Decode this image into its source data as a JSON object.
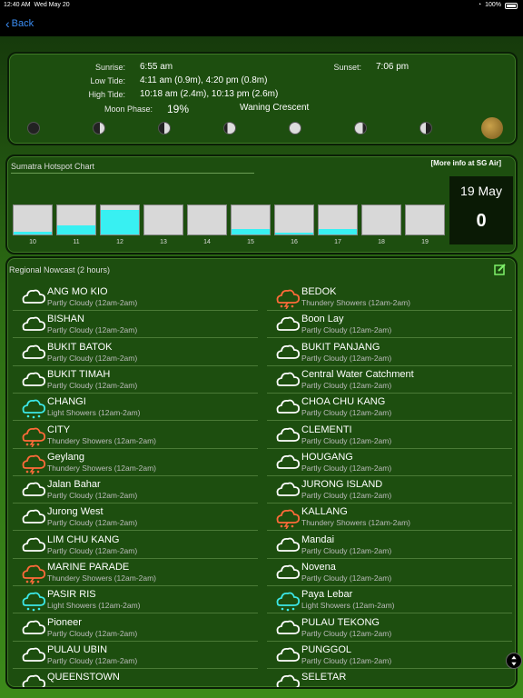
{
  "status": {
    "time": "12:40 AM",
    "date": "Wed May 20",
    "battery": "100%"
  },
  "nav": {
    "back": "Back"
  },
  "info": {
    "sunrise_label": "Sunrise:",
    "sunrise": "6:55 am",
    "sunset_label": "Sunset:",
    "sunset": "7:06 pm",
    "lowtide_label": "Low Tide:",
    "lowtide": "4:11 am (0.9m), 4:20 pm (0.8m)",
    "hightide_label": "High Tide:",
    "hightide": "10:18 am (2.4m), 10:13 pm (2.6m)",
    "moon_label": "Moon Phase:",
    "moon_pct": "19%",
    "moon_phase": "Waning Crescent"
  },
  "hotspot": {
    "title": "Sumatra Hotspot Chart",
    "more": "[More info at SG Air]",
    "date": "19 May",
    "count": "0",
    "chart_data": {
      "type": "bar",
      "categories": [
        "10",
        "11",
        "12",
        "13",
        "14",
        "15",
        "16",
        "17",
        "18",
        "19"
      ],
      "values": [
        0.1,
        0.3,
        0.85,
        0,
        0,
        0.2,
        0.05,
        0.2,
        0,
        0
      ]
    }
  },
  "nowcast": {
    "title": "Regional Nowcast (2 hours)",
    "items": [
      {
        "name": "ANG MO KIO",
        "desc": "Partly Cloudy (12am-2am)",
        "type": "cloud"
      },
      {
        "name": "BEDOK",
        "desc": "Thundery Showers (12am-2am)",
        "type": "thunder"
      },
      {
        "name": "BISHAN",
        "desc": "Partly Cloudy (12am-2am)",
        "type": "cloud"
      },
      {
        "name": "Boon Lay",
        "desc": "Partly Cloudy (12am-2am)",
        "type": "cloud"
      },
      {
        "name": "BUKIT BATOK",
        "desc": "Partly Cloudy (12am-2am)",
        "type": "cloud"
      },
      {
        "name": "BUKIT PANJANG",
        "desc": "Partly Cloudy (12am-2am)",
        "type": "cloud"
      },
      {
        "name": "BUKIT TIMAH",
        "desc": "Partly Cloudy (12am-2am)",
        "type": "cloud"
      },
      {
        "name": "Central Water Catchment",
        "desc": "Partly Cloudy (12am-2am)",
        "type": "cloud"
      },
      {
        "name": "CHANGI",
        "desc": "Light Showers (12am-2am)",
        "type": "shower"
      },
      {
        "name": "CHOA CHU KANG",
        "desc": "Partly Cloudy (12am-2am)",
        "type": "cloud"
      },
      {
        "name": "CITY",
        "desc": "Thundery Showers (12am-2am)",
        "type": "thunder"
      },
      {
        "name": "CLEMENTI",
        "desc": "Partly Cloudy (12am-2am)",
        "type": "cloud"
      },
      {
        "name": "Geylang",
        "desc": "Thundery Showers (12am-2am)",
        "type": "thunder"
      },
      {
        "name": "HOUGANG",
        "desc": "Partly Cloudy (12am-2am)",
        "type": "cloud"
      },
      {
        "name": "Jalan Bahar",
        "desc": "Partly Cloudy (12am-2am)",
        "type": "cloud"
      },
      {
        "name": "JURONG ISLAND",
        "desc": "Partly Cloudy (12am-2am)",
        "type": "cloud"
      },
      {
        "name": "Jurong West",
        "desc": "Partly Cloudy (12am-2am)",
        "type": "cloud"
      },
      {
        "name": "KALLANG",
        "desc": "Thundery Showers (12am-2am)",
        "type": "thunder"
      },
      {
        "name": "LIM CHU KANG",
        "desc": "Partly Cloudy (12am-2am)",
        "type": "cloud"
      },
      {
        "name": "Mandai",
        "desc": "Partly Cloudy (12am-2am)",
        "type": "cloud"
      },
      {
        "name": "MARINE PARADE",
        "desc": "Thundery Showers (12am-2am)",
        "type": "thunder"
      },
      {
        "name": "Novena",
        "desc": "Partly Cloudy (12am-2am)",
        "type": "cloud"
      },
      {
        "name": "PASIR RIS",
        "desc": "Light Showers (12am-2am)",
        "type": "shower"
      },
      {
        "name": "Paya Lebar",
        "desc": "Light Showers (12am-2am)",
        "type": "shower"
      },
      {
        "name": "Pioneer",
        "desc": "Partly Cloudy (12am-2am)",
        "type": "cloud"
      },
      {
        "name": "PULAU TEKONG",
        "desc": "Partly Cloudy (12am-2am)",
        "type": "cloud"
      },
      {
        "name": "PULAU UBIN",
        "desc": "Partly Cloudy (12am-2am)",
        "type": "cloud"
      },
      {
        "name": "PUNGGOL",
        "desc": "Partly Cloudy (12am-2am)",
        "type": "cloud"
      },
      {
        "name": "QUEENSTOWN",
        "desc": "",
        "type": "cloud"
      },
      {
        "name": "SELETAR",
        "desc": "",
        "type": "cloud"
      }
    ]
  },
  "colors": {
    "cloud": "#ffffff",
    "thunder": "#ff6a3a",
    "shower": "#3ce8e8",
    "accent": "#38f0f2"
  }
}
